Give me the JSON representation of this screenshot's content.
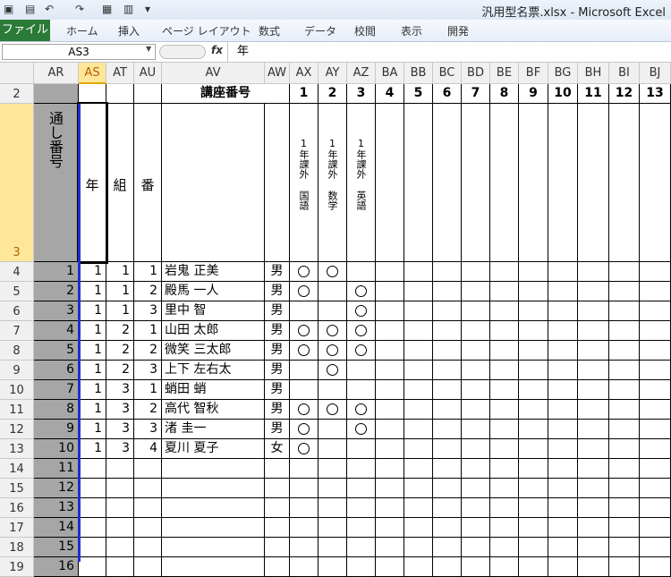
{
  "title_bar": {
    "title": "汎用型名票.xlsx  -  Microsoft Excel"
  },
  "ribbon": {
    "file_tab": "ファイル",
    "tabs": [
      "ホーム",
      "挿入",
      "ページ レイアウト",
      "数式",
      "データ",
      "校閲",
      "表示",
      "開発"
    ]
  },
  "formula_bar": {
    "name_box": "AS3",
    "fx": "fx",
    "content": "年"
  },
  "columns": [
    "AR",
    "AS",
    "AT",
    "AU",
    "AV",
    "AW",
    "AX",
    "AY",
    "AZ",
    "BA",
    "BB",
    "BC",
    "BD",
    "BE",
    "BF",
    "BG",
    "BH",
    "BI",
    "BJ"
  ],
  "rows": [
    "2",
    "3",
    "4",
    "5",
    "6",
    "7",
    "8",
    "9",
    "10",
    "11",
    "12",
    "13",
    "14",
    "15",
    "16",
    "17",
    "18",
    "19"
  ],
  "header": {
    "course_label": "講座番号",
    "course_numbers": [
      "1",
      "2",
      "3",
      "4",
      "5",
      "6",
      "7",
      "8",
      "9",
      "10",
      "11",
      "12",
      "13"
    ],
    "serial_label": "通し番号",
    "year_label": "年",
    "class_label": "組",
    "number_label": "番",
    "courses": [
      "1年課外 国語",
      "1年課外 数学",
      "1年課外 英語"
    ]
  },
  "students": [
    {
      "serial": "1",
      "year": "1",
      "class": "1",
      "no": "1",
      "name": "岩鬼 正美",
      "gender": "男",
      "c1": true,
      "c2": true,
      "c3": false
    },
    {
      "serial": "2",
      "year": "1",
      "class": "1",
      "no": "2",
      "name": "殿馬 一人",
      "gender": "男",
      "c1": true,
      "c2": false,
      "c3": true
    },
    {
      "serial": "3",
      "year": "1",
      "class": "1",
      "no": "3",
      "name": "里中 智",
      "gender": "男",
      "c1": false,
      "c2": false,
      "c3": true
    },
    {
      "serial": "4",
      "year": "1",
      "class": "2",
      "no": "1",
      "name": "山田 太郎",
      "gender": "男",
      "c1": true,
      "c2": true,
      "c3": true
    },
    {
      "serial": "5",
      "year": "1",
      "class": "2",
      "no": "2",
      "name": "微笑 三太郎",
      "gender": "男",
      "c1": true,
      "c2": true,
      "c3": true
    },
    {
      "serial": "6",
      "year": "1",
      "class": "2",
      "no": "3",
      "name": "上下 左右太",
      "gender": "男",
      "c1": false,
      "c2": true,
      "c3": false
    },
    {
      "serial": "7",
      "year": "1",
      "class": "3",
      "no": "1",
      "name": "蛸田 蛸",
      "gender": "男",
      "c1": false,
      "c2": false,
      "c3": false
    },
    {
      "serial": "8",
      "year": "1",
      "class": "3",
      "no": "2",
      "name": "高代 智秋",
      "gender": "男",
      "c1": true,
      "c2": true,
      "c3": true
    },
    {
      "serial": "9",
      "year": "1",
      "class": "3",
      "no": "3",
      "name": "渚 圭一",
      "gender": "男",
      "c1": true,
      "c2": false,
      "c3": true
    },
    {
      "serial": "10",
      "year": "1",
      "class": "3",
      "no": "4",
      "name": "夏川 夏子",
      "gender": "女",
      "c1": true,
      "c2": false,
      "c3": false
    }
  ],
  "empty_serials": [
    "11",
    "12",
    "13",
    "14",
    "15",
    "16"
  ]
}
